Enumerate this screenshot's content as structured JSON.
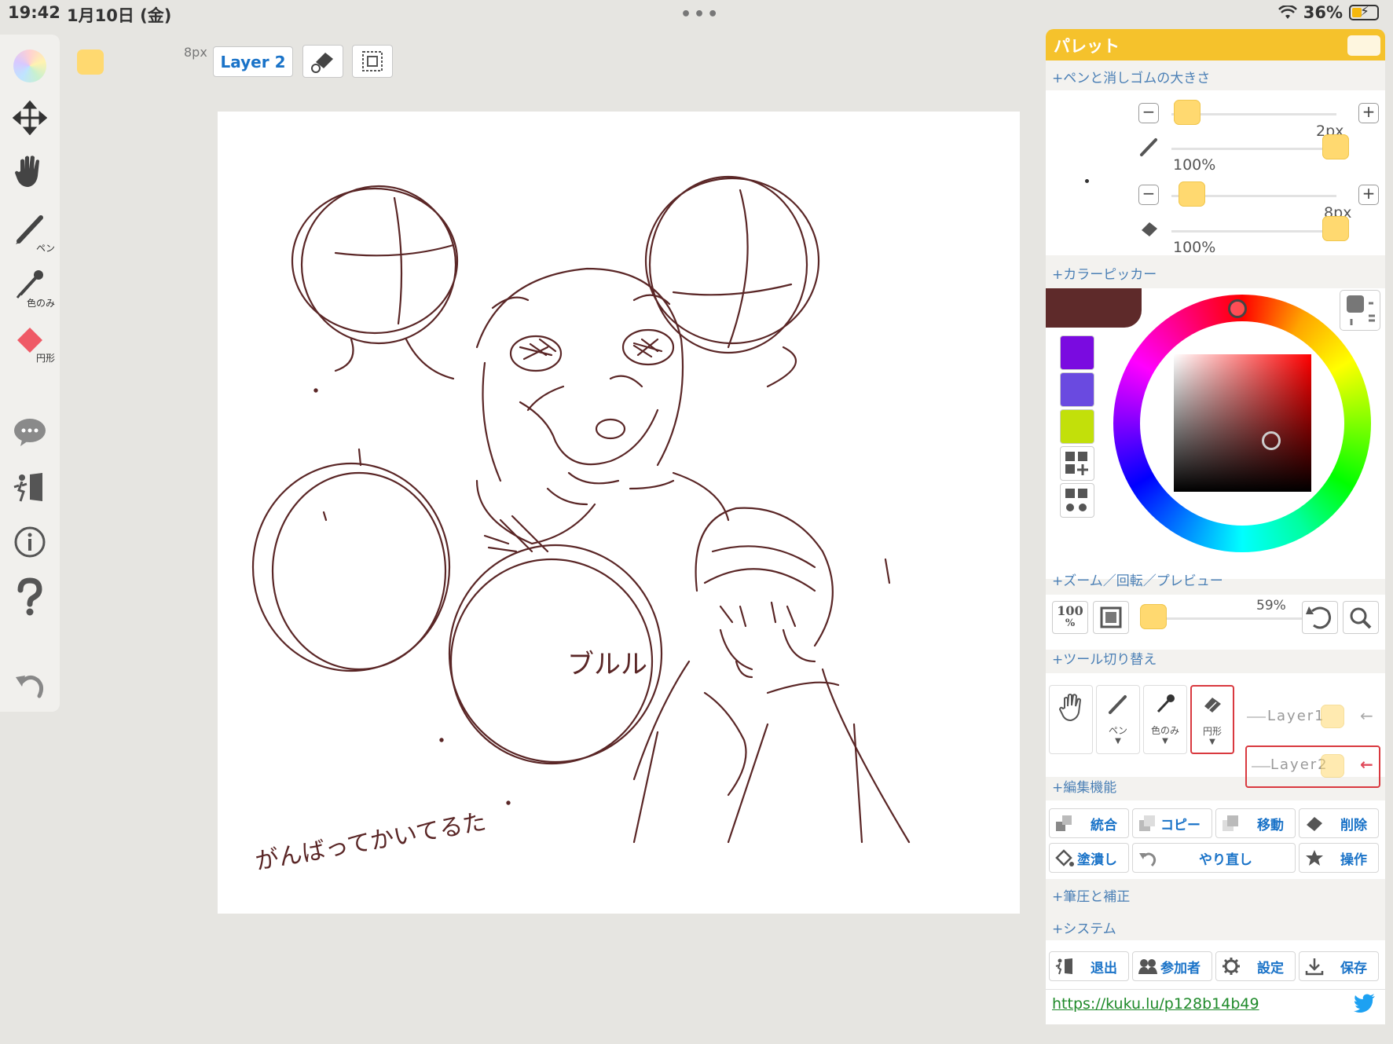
{
  "status": {
    "time": "19:42",
    "date": "1月10日 (金)",
    "dots": "•••",
    "battery": "36%"
  },
  "left_toolbar": {
    "pen_label": "ペン",
    "eyedropper_label": "色のみ",
    "shape_label": "円形"
  },
  "top": {
    "size_label": "8px",
    "layer_button": "Layer 2"
  },
  "canvas": {
    "handwritten_text": "がんばってかいてるた",
    "bubble_text": "ブルル"
  },
  "palette": {
    "title": "パレット",
    "sec_pen_eraser": "+ペンと消しゴムの大きさ",
    "pen_size": "2px",
    "pen_opacity": "100%",
    "eraser_size": "8px",
    "eraser_opacity": "100%",
    "sec_color_picker": "+カラーピッカー",
    "current_color": "#5e2a2a",
    "swatches": [
      "#7a0be0",
      "#6a4ae0",
      "#c2e00a"
    ],
    "sec_zoom": "+ズーム／回転／プレビュー",
    "zoom_100": "100",
    "zoom_pct_symbol": "%",
    "zoom_value": "59%",
    "sec_tool_switch": "+ツール切り替え",
    "tool_pen": "ペン",
    "tool_eyedropper": "色のみ",
    "tool_shape": "円形",
    "layer1": "Layer1",
    "layer2": "Layer2",
    "sec_edit": "+編集機能",
    "btn_merge": "統合",
    "btn_copy": "コピー",
    "btn_move": "移動",
    "btn_delete": "削除",
    "btn_fill": "塗潰し",
    "btn_redo": "やり直し",
    "btn_ops": "操作",
    "sec_pressure": "+筆圧と補正",
    "sec_system": "+システム",
    "btn_exit": "退出",
    "btn_participants": "参加者",
    "btn_settings": "設定",
    "btn_save": "保存",
    "url": "https://kuku.lu/p128b14b49"
  }
}
